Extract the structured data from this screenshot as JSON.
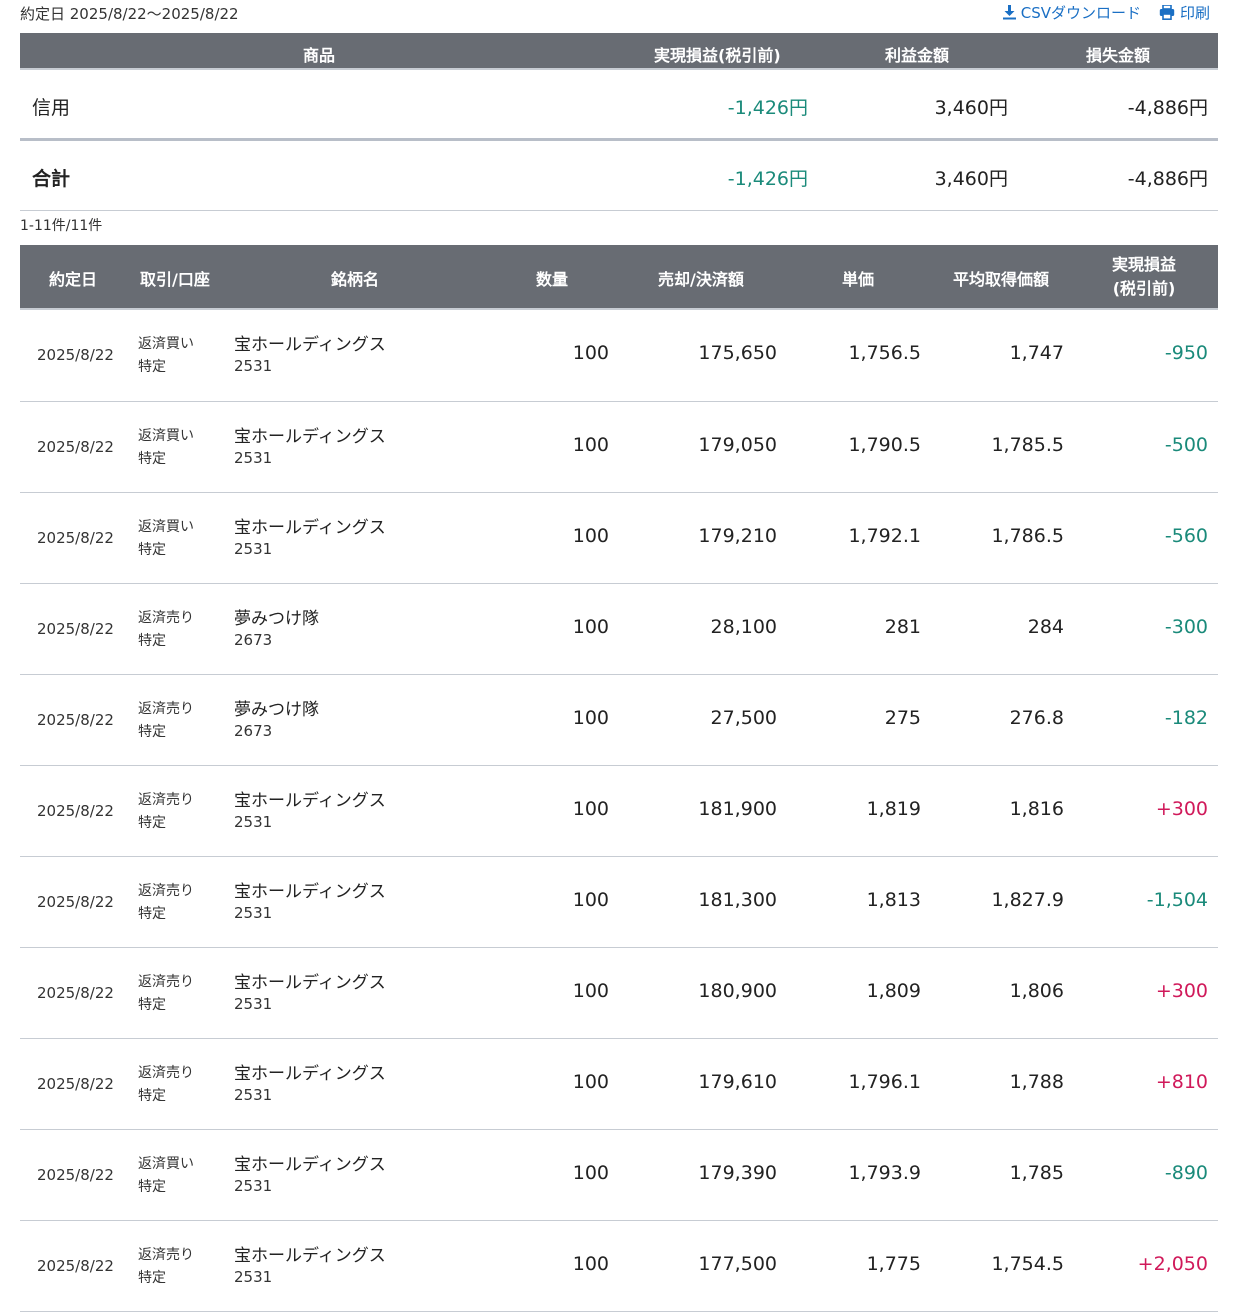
{
  "header": {
    "date_range": "約定日 2025/8/22〜2025/8/22",
    "csv_label": "CSVダウンロード",
    "print_label": "印刷"
  },
  "summary": {
    "columns": [
      "商品",
      "実現損益(税引前)",
      "利益金額",
      "損失金額"
    ],
    "rows": [
      {
        "product": "信用",
        "realized": "-1,426円",
        "profit": "3,460円",
        "loss": "-4,886円"
      }
    ],
    "total": {
      "product": "合計",
      "realized": "-1,426円",
      "profit": "3,460円",
      "loss": "-4,886円"
    }
  },
  "count_text": "1-11件/11件",
  "detail": {
    "columns": {
      "date": "約定日",
      "type": "取引/口座",
      "name": "銘柄名",
      "qty": "数量",
      "amount": "売却/決済額",
      "price": "単価",
      "avg": "平均取得価額",
      "pl_line1": "実現損益",
      "pl_line2": "(税引前)"
    },
    "rows": [
      {
        "date": "2025/8/22",
        "type": "返済買い",
        "account": "特定",
        "name": "宝ホールディングス",
        "code": "2531",
        "qty": "100",
        "amount": "175,650",
        "price": "1,756.5",
        "avg": "1,747",
        "pl": "-950",
        "sign": "neg"
      },
      {
        "date": "2025/8/22",
        "type": "返済買い",
        "account": "特定",
        "name": "宝ホールディングス",
        "code": "2531",
        "qty": "100",
        "amount": "179,050",
        "price": "1,790.5",
        "avg": "1,785.5",
        "pl": "-500",
        "sign": "neg"
      },
      {
        "date": "2025/8/22",
        "type": "返済買い",
        "account": "特定",
        "name": "宝ホールディングス",
        "code": "2531",
        "qty": "100",
        "amount": "179,210",
        "price": "1,792.1",
        "avg": "1,786.5",
        "pl": "-560",
        "sign": "neg"
      },
      {
        "date": "2025/8/22",
        "type": "返済売り",
        "account": "特定",
        "name": "夢みつけ隊",
        "code": "2673",
        "qty": "100",
        "amount": "28,100",
        "price": "281",
        "avg": "284",
        "pl": "-300",
        "sign": "neg"
      },
      {
        "date": "2025/8/22",
        "type": "返済売り",
        "account": "特定",
        "name": "夢みつけ隊",
        "code": "2673",
        "qty": "100",
        "amount": "27,500",
        "price": "275",
        "avg": "276.8",
        "pl": "-182",
        "sign": "neg"
      },
      {
        "date": "2025/8/22",
        "type": "返済売り",
        "account": "特定",
        "name": "宝ホールディングス",
        "code": "2531",
        "qty": "100",
        "amount": "181,900",
        "price": "1,819",
        "avg": "1,816",
        "pl": "+300",
        "sign": "pos"
      },
      {
        "date": "2025/8/22",
        "type": "返済売り",
        "account": "特定",
        "name": "宝ホールディングス",
        "code": "2531",
        "qty": "100",
        "amount": "181,300",
        "price": "1,813",
        "avg": "1,827.9",
        "pl": "-1,504",
        "sign": "neg"
      },
      {
        "date": "2025/8/22",
        "type": "返済売り",
        "account": "特定",
        "name": "宝ホールディングス",
        "code": "2531",
        "qty": "100",
        "amount": "180,900",
        "price": "1,809",
        "avg": "1,806",
        "pl": "+300",
        "sign": "pos"
      },
      {
        "date": "2025/8/22",
        "type": "返済売り",
        "account": "特定",
        "name": "宝ホールディングス",
        "code": "2531",
        "qty": "100",
        "amount": "179,610",
        "price": "1,796.1",
        "avg": "1,788",
        "pl": "+810",
        "sign": "pos"
      },
      {
        "date": "2025/8/22",
        "type": "返済買い",
        "account": "特定",
        "name": "宝ホールディングス",
        "code": "2531",
        "qty": "100",
        "amount": "179,390",
        "price": "1,793.9",
        "avg": "1,785",
        "pl": "-890",
        "sign": "neg"
      },
      {
        "date": "2025/8/22",
        "type": "返済売り",
        "account": "特定",
        "name": "宝ホールディングス",
        "code": "2531",
        "qty": "100",
        "amount": "177,500",
        "price": "1,775",
        "avg": "1,754.5",
        "pl": "+2,050",
        "sign": "pos"
      }
    ]
  },
  "colors": {
    "header_bg": "#686c73",
    "link": "#1a6fc4",
    "negative": "#1a8a7a",
    "positive": "#d0195a"
  },
  "icons": {
    "csv": "download-icon",
    "print": "printer-icon"
  }
}
